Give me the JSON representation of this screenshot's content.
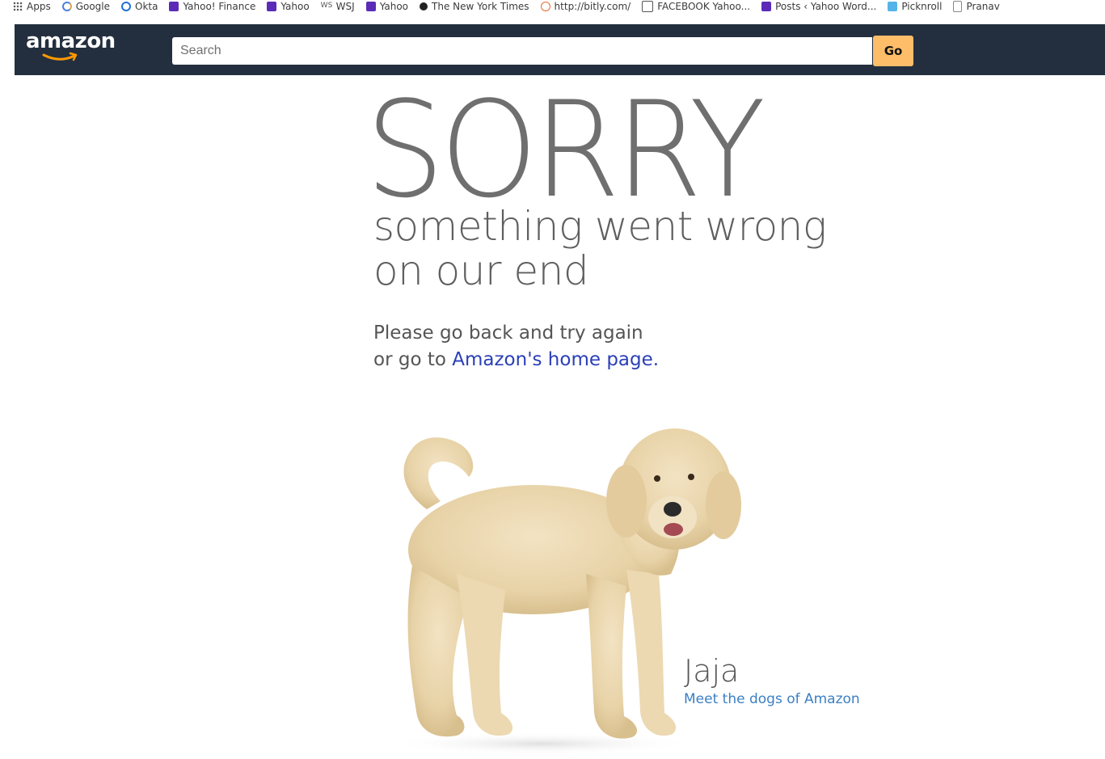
{
  "bookmarks": [
    {
      "label": "Apps",
      "icon": "apps-grid-icon"
    },
    {
      "label": "Google",
      "icon": "google-icon"
    },
    {
      "label": "Okta",
      "icon": "okta-icon"
    },
    {
      "label": "Yahoo! Finance",
      "icon": "yahoo-icon"
    },
    {
      "label": "Yahoo",
      "icon": "yahoo-icon"
    },
    {
      "label": "WSJ",
      "icon": "wsj-icon"
    },
    {
      "label": "Yahoo",
      "icon": "yahoo-icon"
    },
    {
      "label": "The New York Times",
      "icon": "nyt-icon"
    },
    {
      "label": "http://bitly.com/",
      "icon": "bitly-icon"
    },
    {
      "label": "FACEBOOK Yahoo...",
      "icon": "facebook-icon"
    },
    {
      "label": "Posts ‹ Yahoo Word...",
      "icon": "yahoo-icon"
    },
    {
      "label": "Picknroll",
      "icon": "picknroll-icon"
    },
    {
      "label": "Pranav",
      "icon": "document-icon"
    }
  ],
  "header": {
    "logo_text": "amazon",
    "search_placeholder": "Search",
    "go_label": "Go",
    "colors": {
      "bar": "#232f3e",
      "go_button": "#febd69"
    }
  },
  "error": {
    "headline": "SORRY",
    "subline1": "something went wrong",
    "subline2": "on our end",
    "message_line1": "Please go back and try again",
    "message_prefix": "or go to ",
    "home_link": "Amazon's home page."
  },
  "dog": {
    "name": "Jaja",
    "link": "Meet the dogs of Amazon"
  }
}
